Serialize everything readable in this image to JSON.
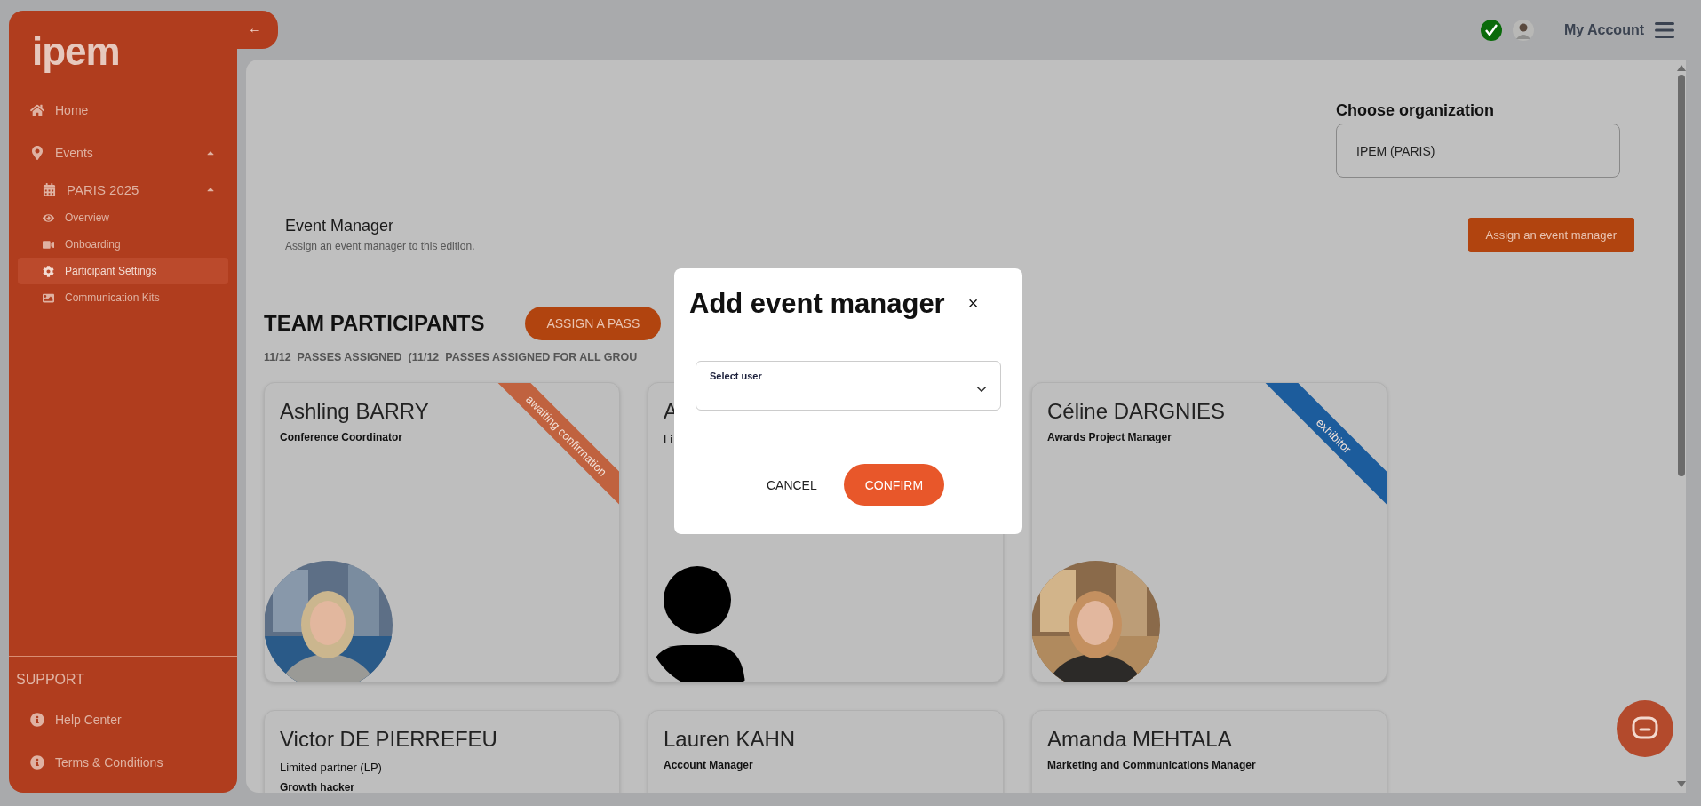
{
  "sidebar": {
    "logo": "ipem",
    "back_button": "←",
    "items": [
      {
        "label": "Home",
        "selected": false
      },
      {
        "label": "Events",
        "selected": false,
        "expanded": true,
        "children": [
          {
            "label": "PARIS 2025",
            "selected": false,
            "expanded": true,
            "children": [
              {
                "label": "Overview",
                "selected": false
              },
              {
                "label": "Onboarding",
                "selected": false
              },
              {
                "label": "Participant Settings",
                "selected": true
              },
              {
                "label": "Communication Kits",
                "selected": false
              }
            ]
          }
        ]
      }
    ],
    "support": {
      "title": "SUPPORT",
      "items": [
        {
          "label": "Help Center"
        },
        {
          "label": "Terms & Conditions"
        }
      ]
    }
  },
  "topbar": {
    "account": "My Account"
  },
  "organization": {
    "label": "Choose organization",
    "value": "IPEM (PARIS)"
  },
  "event_manager": {
    "title": "Event Manager",
    "subtitle": "Assign an event manager to this edition.",
    "button": "Assign an event manager"
  },
  "team": {
    "title": "TEAM PARTICIPANTS",
    "button": "ASSIGN A PASS",
    "summary": "11/12  PASSES ASSIGNED  (11/12  PASSES ASSIGNED FOR ALL GROU",
    "cards": [
      {
        "name": "Ashling BARRY",
        "lines": [
          {
            "kind": "bold",
            "text": "Conference Coordinator"
          }
        ],
        "ribbon": {
          "label": "awaiting confirmation",
          "color": "#c0623f"
        },
        "avatar": {
          "kind": "picture"
        }
      },
      {
        "name": "A",
        "lines": [
          {
            "kind": "plain",
            "text": "Li"
          }
        ],
        "avatar": {
          "kind": "silhouette"
        }
      },
      {
        "name": "Céline DARGNIES",
        "lines": [
          {
            "kind": "bold",
            "text": "Awards Project Manager"
          }
        ],
        "ribbon": {
          "label": "exhibitor",
          "color": "#1c5c9c"
        },
        "avatar": {
          "kind": "picture"
        }
      },
      {
        "name": "Victor DE PIERREFEU",
        "lines": [
          {
            "kind": "plain",
            "text": "Limited partner (LP)"
          },
          {
            "kind": "bold",
            "text": "Growth hacker"
          }
        ]
      },
      {
        "name": "Lauren KAHN",
        "lines": [
          {
            "kind": "bold",
            "text": "Account Manager"
          }
        ]
      },
      {
        "name": "Amanda MEHTALA",
        "lines": [
          {
            "kind": "bold",
            "text": "Marketing and Communications Manager"
          }
        ]
      }
    ]
  },
  "modal": {
    "title": "Add event manager",
    "close": "×",
    "field": {
      "label": "Select user"
    },
    "cancel": "CANCEL",
    "confirm": "CONFIRM"
  }
}
